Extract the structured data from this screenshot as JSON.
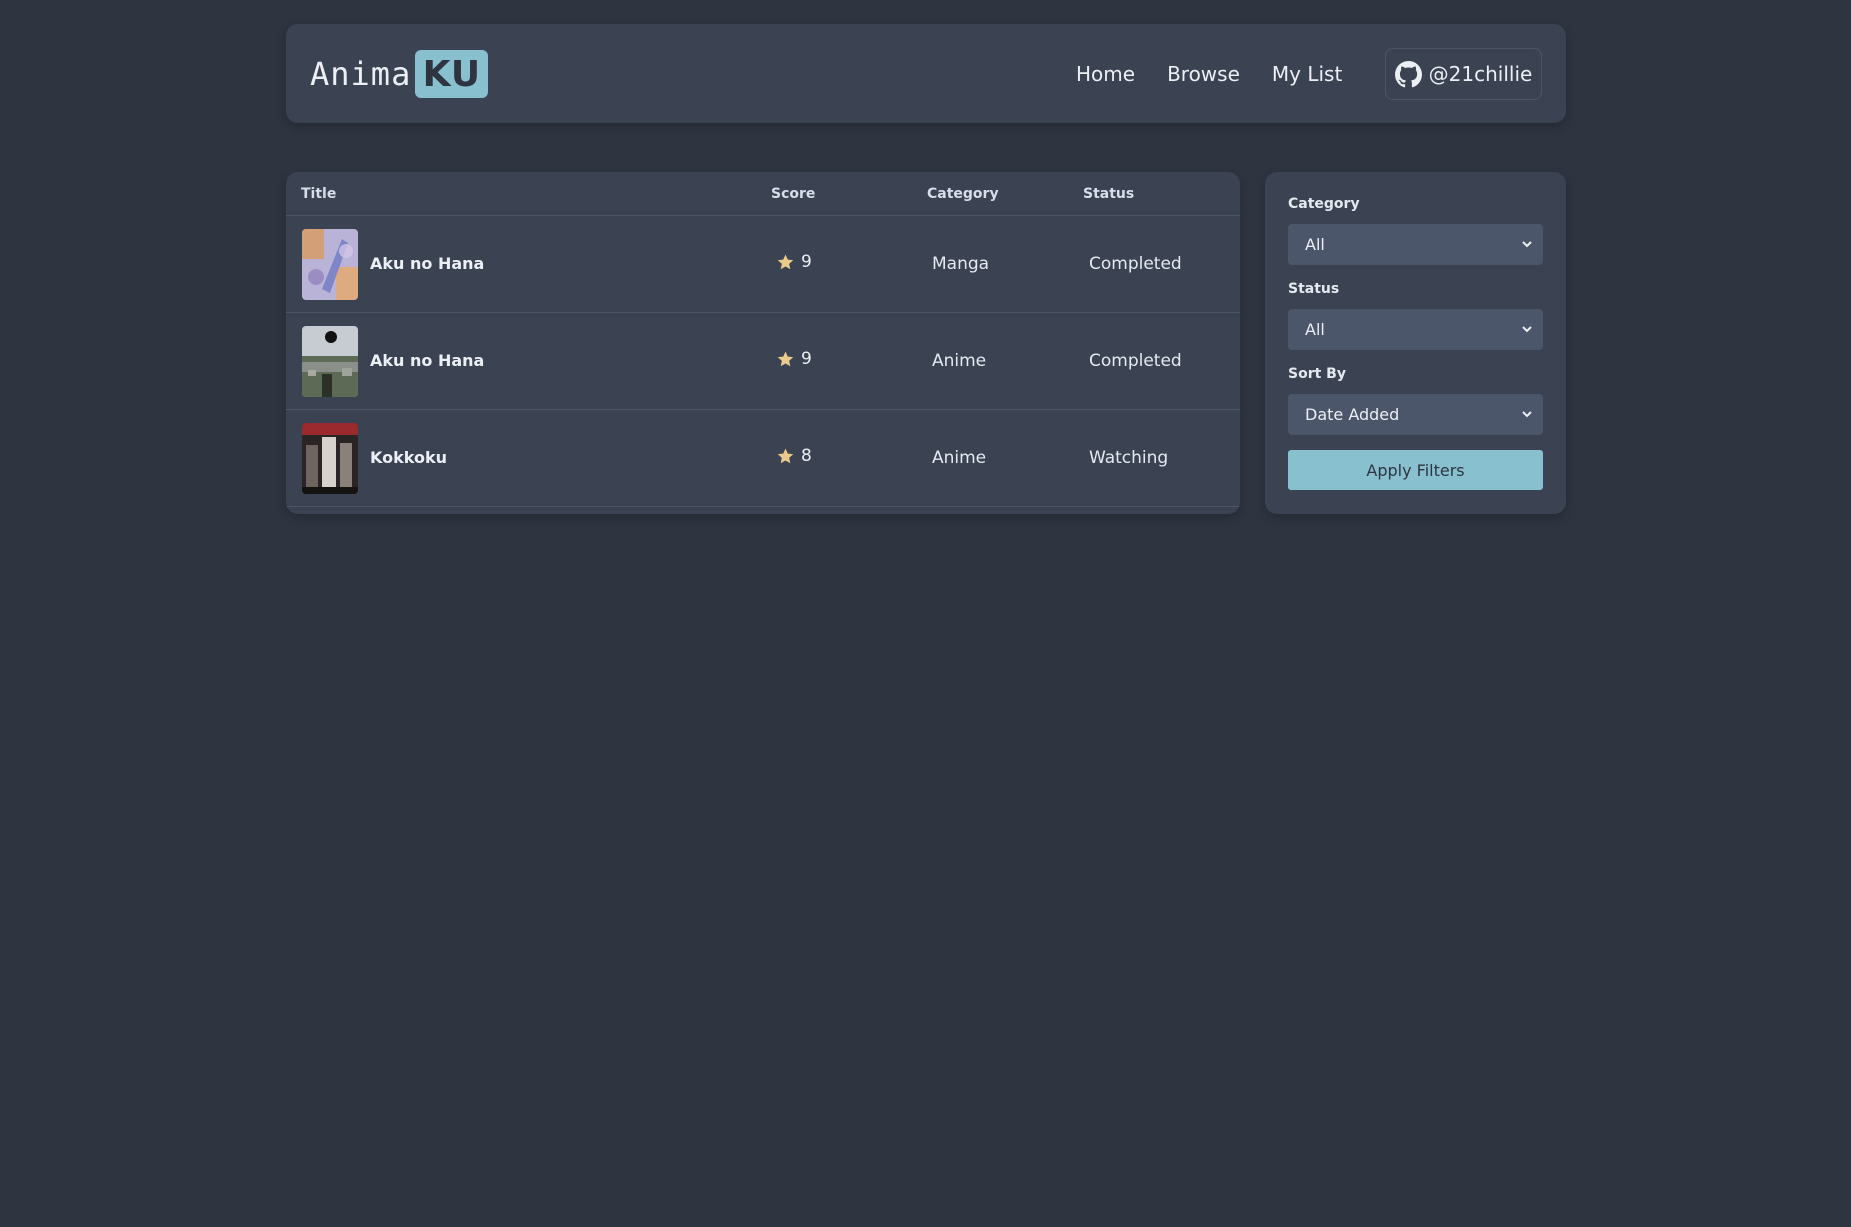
{
  "brand": {
    "text": "Anima",
    "badge": "KU"
  },
  "nav": {
    "home": "Home",
    "browse": "Browse",
    "my_list": "My List"
  },
  "github": {
    "handle": "@21chillie",
    "icon": "github-icon"
  },
  "table": {
    "headers": {
      "title": "Title",
      "score": "Score",
      "category": "Category",
      "status": "Status"
    },
    "rows": [
      {
        "title": "Aku no Hana",
        "score": "9",
        "category": "Manga",
        "status": "Completed"
      },
      {
        "title": "Aku no Hana",
        "score": "9",
        "category": "Anime",
        "status": "Completed"
      },
      {
        "title": "Kokkoku",
        "score": "8",
        "category": "Anime",
        "status": "Watching"
      }
    ]
  },
  "filters": {
    "category_label": "Category",
    "category_value": "All",
    "status_label": "Status",
    "status_value": "All",
    "sort_label": "Sort By",
    "sort_value": "Date Added",
    "apply_label": "Apply Filters"
  },
  "colors": {
    "background": "#2e3440",
    "card": "#3b4252",
    "accent": "#88c0d0",
    "star": "#ebcb8b"
  }
}
